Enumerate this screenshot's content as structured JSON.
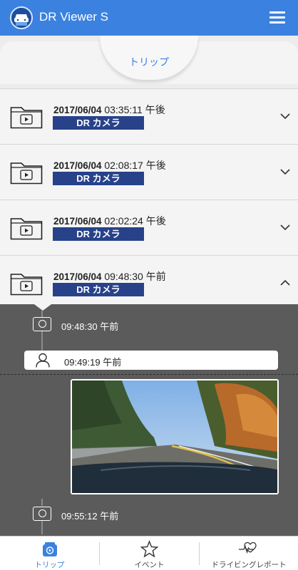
{
  "app": {
    "title": "DR Viewer S"
  },
  "tab": {
    "label": "トリップ"
  },
  "trips": [
    {
      "date": "2017/06/04",
      "time": "03:35:11 午後",
      "badge": "DR カメラ",
      "expanded": false
    },
    {
      "date": "2017/06/04",
      "time": "02:08:17 午後",
      "badge": "DR カメラ",
      "expanded": false
    },
    {
      "date": "2017/06/04",
      "time": "02:02:24 午後",
      "badge": "DR カメラ",
      "expanded": false
    },
    {
      "date": "2017/06/04",
      "time": "09:48:30 午前",
      "badge": "DR カメラ",
      "expanded": true
    }
  ],
  "timeline": {
    "start_time": "09:48:30 午前",
    "event_time": "09:49:19 午前",
    "end_time": "09:55:12 午前"
  },
  "nav": [
    {
      "label": "トリップ",
      "icon": "trip-icon",
      "active": true
    },
    {
      "label": "イベント",
      "icon": "star-icon",
      "active": false
    },
    {
      "label": "ドライビングレポート",
      "icon": "heart-pulse-icon",
      "active": false
    }
  ],
  "colors": {
    "accent": "#3b82e0",
    "badge": "#28428a",
    "timeline_bg": "#5b5b5b"
  }
}
